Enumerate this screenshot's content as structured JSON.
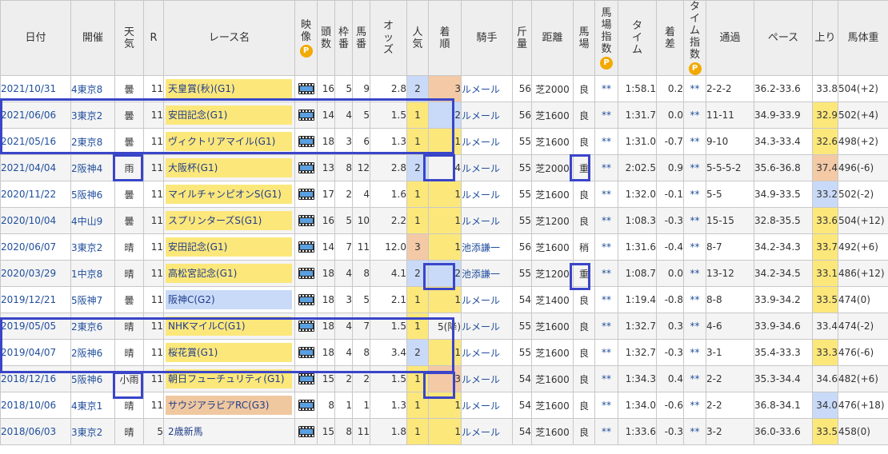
{
  "headers": {
    "date": "日付",
    "venue": "開催",
    "weather": "天気",
    "r": "R",
    "race_name": "レース名",
    "video": "映像",
    "heads": "頭数",
    "frame": "枠番",
    "horse_no": "馬番",
    "odds": "オッズ",
    "popularity": "人気",
    "finish": "着順",
    "jockey": "騎手",
    "weight_carried": "斤量",
    "distance": "距離",
    "track": "馬場",
    "track_index": "馬場指数",
    "time": "タイム",
    "margin": "着差",
    "time_index": "タイム指数",
    "passing": "通過",
    "pace": "ペース",
    "last3f": "上り",
    "body_weight": "馬体重",
    "premium_badge": "P"
  },
  "colors": {
    "g1": "#fce77b",
    "g2": "#c9daf8",
    "g3": "#f0c8a0",
    "highlight_box": "#3a45c8",
    "link": "#1f4e9c"
  },
  "rows": [
    {
      "date": "2021/10/31",
      "venue": "4東京8",
      "weather": "曇",
      "r": "11",
      "race": "天皇賞(秋)(G1)",
      "grade": "g1",
      "heads": "16",
      "frame": "5",
      "num": "9",
      "odds": "2.8",
      "pop": "2",
      "popc": "pop-blue",
      "fin": "3",
      "finc": "fin-orange",
      "jockey": "ルメール",
      "kin": "56",
      "dist": "芝2000",
      "track": "良",
      "tidx": "**",
      "time": "1:58.1",
      "margin": "0.2",
      "tmidx": "**",
      "pass": "2-2-2",
      "pace": "36.2-33.6",
      "agari": "33.8",
      "agc": "",
      "bw": "504(+2)"
    },
    {
      "date": "2021/06/06",
      "venue": "3東京2",
      "weather": "曇",
      "r": "11",
      "race": "安田記念(G1)",
      "grade": "g1",
      "heads": "14",
      "frame": "4",
      "num": "5",
      "odds": "1.5",
      "pop": "1",
      "popc": "pop-yellow",
      "fin": "2",
      "finc": "fin-blue",
      "jockey": "ルメール",
      "kin": "56",
      "dist": "芝1600",
      "track": "良",
      "tidx": "**",
      "time": "1:31.7",
      "margin": "0.0",
      "tmidx": "**",
      "pass": "11-11",
      "pace": "34.9-33.9",
      "agari": "32.9",
      "agc": "ag-yellow",
      "bw": "502(+4)"
    },
    {
      "date": "2021/05/16",
      "venue": "2東京8",
      "weather": "曇",
      "r": "11",
      "race": "ヴィクトリアマイル(G1)",
      "grade": "g1",
      "heads": "18",
      "frame": "3",
      "num": "6",
      "odds": "1.3",
      "pop": "1",
      "popc": "pop-yellow",
      "fin": "1",
      "finc": "fin-yellow",
      "jockey": "ルメール",
      "kin": "55",
      "dist": "芝1600",
      "track": "良",
      "tidx": "**",
      "time": "1:31.0",
      "margin": "-0.7",
      "tmidx": "**",
      "pass": "9-10",
      "pace": "34.3-33.4",
      "agari": "32.6",
      "agc": "ag-yellow",
      "bw": "498(+2)"
    },
    {
      "date": "2021/04/04",
      "venue": "2阪神4",
      "weather": "雨",
      "r": "11",
      "race": "大阪杯(G1)",
      "grade": "g1",
      "heads": "13",
      "frame": "8",
      "num": "12",
      "odds": "2.8",
      "pop": "2",
      "popc": "pop-blue",
      "fin": "4",
      "finc": "",
      "jockey": "ルメール",
      "kin": "55",
      "dist": "芝2000",
      "track": "重",
      "tidx": "**",
      "time": "2:02.5",
      "margin": "0.9",
      "tmidx": "**",
      "pass": "5-5-5-2",
      "pace": "35.6-36.8",
      "agari": "37.4",
      "agc": "ag-orange",
      "bw": "496(-6)"
    },
    {
      "date": "2020/11/22",
      "venue": "5阪神6",
      "weather": "曇",
      "r": "11",
      "race": "マイルチャンピオンS(G1)",
      "grade": "g1",
      "heads": "17",
      "frame": "2",
      "num": "4",
      "odds": "1.6",
      "pop": "1",
      "popc": "pop-yellow",
      "fin": "1",
      "finc": "fin-yellow",
      "jockey": "ルメール",
      "kin": "55",
      "dist": "芝1600",
      "track": "良",
      "tidx": "**",
      "time": "1:32.0",
      "margin": "-0.1",
      "tmidx": "**",
      "pass": "5-5",
      "pace": "34.9-33.5",
      "agari": "33.2",
      "agc": "ag-blue",
      "bw": "502(-2)"
    },
    {
      "date": "2020/10/04",
      "venue": "4中山9",
      "weather": "曇",
      "r": "11",
      "race": "スプリンターズS(G1)",
      "grade": "g1",
      "heads": "16",
      "frame": "5",
      "num": "10",
      "odds": "2.2",
      "pop": "1",
      "popc": "pop-yellow",
      "fin": "1",
      "finc": "fin-yellow",
      "jockey": "ルメール",
      "kin": "55",
      "dist": "芝1200",
      "track": "良",
      "tidx": "**",
      "time": "1:08.3",
      "margin": "-0.3",
      "tmidx": "**",
      "pass": "15-15",
      "pace": "32.8-35.5",
      "agari": "33.6",
      "agc": "ag-yellow",
      "bw": "504(+12)"
    },
    {
      "date": "2020/06/07",
      "venue": "3東京2",
      "weather": "晴",
      "r": "11",
      "race": "安田記念(G1)",
      "grade": "g1",
      "heads": "14",
      "frame": "7",
      "num": "11",
      "odds": "12.0",
      "pop": "3",
      "popc": "pop-orange",
      "fin": "1",
      "finc": "fin-yellow",
      "jockey": "池添謙一",
      "kin": "56",
      "dist": "芝1600",
      "track": "稍",
      "tidx": "**",
      "time": "1:31.6",
      "margin": "-0.4",
      "tmidx": "**",
      "pass": "8-7",
      "pace": "34.2-34.3",
      "agari": "33.7",
      "agc": "ag-yellow",
      "bw": "492(+6)"
    },
    {
      "date": "2020/03/29",
      "venue": "1中京8",
      "weather": "晴",
      "r": "11",
      "race": "高松宮記念(G1)",
      "grade": "g1",
      "heads": "18",
      "frame": "4",
      "num": "8",
      "odds": "4.1",
      "pop": "2",
      "popc": "pop-blue",
      "fin": "2",
      "finc": "fin-blue",
      "jockey": "池添謙一",
      "kin": "55",
      "dist": "芝1200",
      "track": "重",
      "tidx": "**",
      "time": "1:08.7",
      "margin": "0.0",
      "tmidx": "**",
      "pass": "13-12",
      "pace": "34.2-34.5",
      "agari": "33.1",
      "agc": "ag-yellow",
      "bw": "486(+12)"
    },
    {
      "date": "2019/12/21",
      "venue": "5阪神7",
      "weather": "曇",
      "r": "11",
      "race": "阪神C(G2)",
      "grade": "g2",
      "heads": "18",
      "frame": "3",
      "num": "5",
      "odds": "2.1",
      "pop": "1",
      "popc": "pop-yellow",
      "fin": "1",
      "finc": "fin-yellow",
      "jockey": "ルメール",
      "kin": "54",
      "dist": "芝1400",
      "track": "良",
      "tidx": "**",
      "time": "1:19.4",
      "margin": "-0.8",
      "tmidx": "**",
      "pass": "8-8",
      "pace": "33.9-34.2",
      "agari": "33.5",
      "agc": "ag-yellow",
      "bw": "474(0)"
    },
    {
      "date": "2019/05/05",
      "venue": "2東京6",
      "weather": "晴",
      "r": "11",
      "race": "NHKマイルC(G1)",
      "grade": "g1",
      "heads": "18",
      "frame": "4",
      "num": "7",
      "odds": "1.5",
      "pop": "1",
      "popc": "pop-yellow",
      "fin": "5(降)",
      "finc": "",
      "jockey": "ルメール",
      "kin": "55",
      "dist": "芝1600",
      "track": "良",
      "tidx": "**",
      "time": "1:32.7",
      "margin": "0.3",
      "tmidx": "**",
      "pass": "4-6",
      "pace": "33.9-34.6",
      "agari": "33.4",
      "agc": "",
      "bw": "474(-2)"
    },
    {
      "date": "2019/04/07",
      "venue": "2阪神6",
      "weather": "晴",
      "r": "11",
      "race": "桜花賞(G1)",
      "grade": "g1",
      "heads": "18",
      "frame": "4",
      "num": "8",
      "odds": "3.4",
      "pop": "2",
      "popc": "pop-blue",
      "fin": "1",
      "finc": "fin-yellow",
      "jockey": "ルメール",
      "kin": "55",
      "dist": "芝1600",
      "track": "良",
      "tidx": "**",
      "time": "1:32.7",
      "margin": "-0.3",
      "tmidx": "**",
      "pass": "3-1",
      "pace": "35.4-33.3",
      "agari": "33.3",
      "agc": "ag-yellow",
      "bw": "476(-6)"
    },
    {
      "date": "2018/12/16",
      "venue": "5阪神6",
      "weather": "小雨",
      "r": "11",
      "race": "朝日フューチュリティ(G1)",
      "grade": "g1",
      "heads": "15",
      "frame": "2",
      "num": "2",
      "odds": "1.5",
      "pop": "1",
      "popc": "pop-yellow",
      "fin": "3",
      "finc": "fin-orange",
      "jockey": "ルメール",
      "kin": "54",
      "dist": "芝1600",
      "track": "良",
      "tidx": "**",
      "time": "1:34.3",
      "margin": "0.4",
      "tmidx": "**",
      "pass": "2-2",
      "pace": "35.3-34.4",
      "agari": "34.6",
      "agc": "",
      "bw": "482(+6)"
    },
    {
      "date": "2018/10/06",
      "venue": "4東京1",
      "weather": "晴",
      "r": "11",
      "race": "サウジアラビアRC(G3)",
      "grade": "g3",
      "heads": "8",
      "frame": "1",
      "num": "1",
      "odds": "1.3",
      "pop": "1",
      "popc": "pop-yellow",
      "fin": "1",
      "finc": "fin-yellow",
      "jockey": "ルメール",
      "kin": "54",
      "dist": "芝1600",
      "track": "良",
      "tidx": "**",
      "time": "1:34.0",
      "margin": "-0.6",
      "tmidx": "**",
      "pass": "2-2",
      "pace": "36.8-34.1",
      "agari": "34.0",
      "agc": "ag-blue",
      "bw": "476(+18)"
    },
    {
      "date": "2018/06/03",
      "venue": "3東京2",
      "weather": "晴",
      "r": "5",
      "race": "2歳新馬",
      "grade": "nr",
      "heads": "15",
      "frame": "8",
      "num": "11",
      "odds": "1.8",
      "pop": "1",
      "popc": "pop-yellow",
      "fin": "1",
      "finc": "fin-yellow",
      "jockey": "ルメール",
      "kin": "54",
      "dist": "芝1600",
      "track": "良",
      "tidx": "**",
      "time": "1:33.6",
      "margin": "-0.3",
      "tmidx": "**",
      "pass": "3-2",
      "pace": "36.0-33.6",
      "agari": "33.5",
      "agc": "ag-yellow",
      "bw": "458(0)"
    }
  ]
}
